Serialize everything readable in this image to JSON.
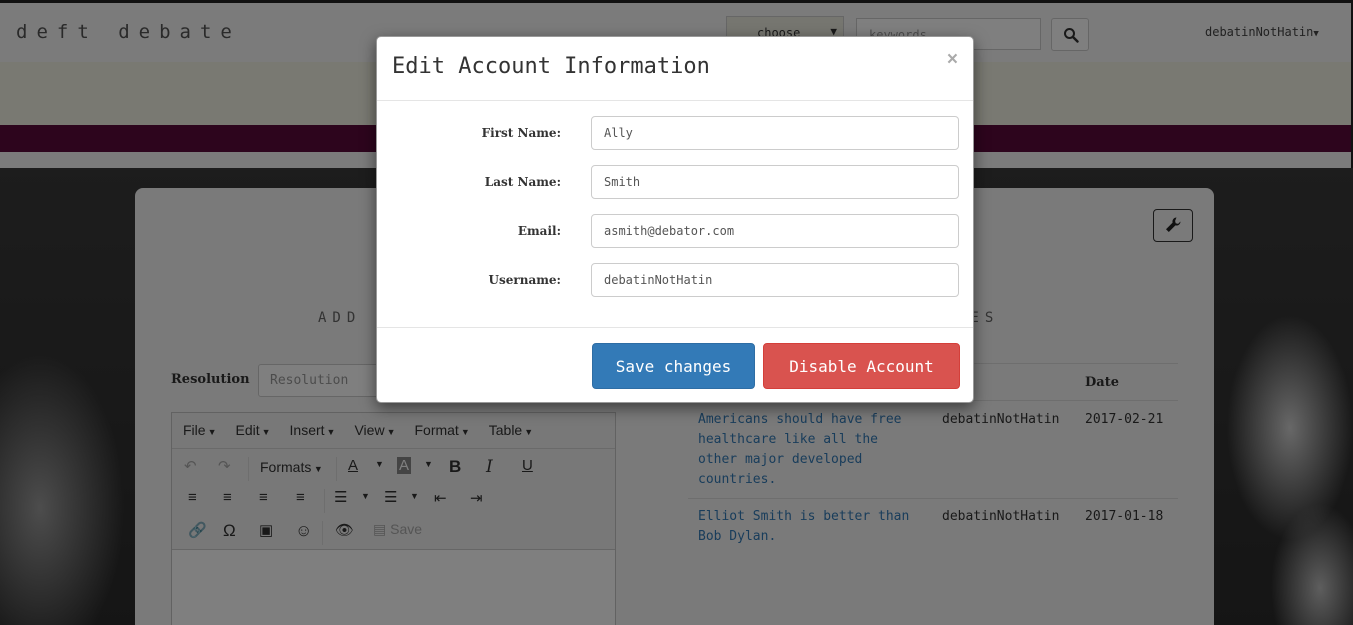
{
  "navbar": {
    "brand": "deft debate",
    "choose_label": "choose",
    "search_placeholder": "keywords",
    "user_label": "debatinNotHatin"
  },
  "panel": {
    "left_section_heading": "ADD",
    "right_section_heading": "TES",
    "resolution_label": "Resolution",
    "resolution_placeholder": "Resolution",
    "editor": {
      "menus": [
        "File",
        "Edit",
        "Insert",
        "View",
        "Format",
        "Table"
      ],
      "formats_label": "Formats",
      "save_label": "Save"
    },
    "table": {
      "date_header": "Date",
      "rows": [
        {
          "title": "Americans should have free healthcare like all the other major developed countries.",
          "title_lines": [
            "Americans should have free",
            "healthcare like all the",
            "other major developed",
            "countries."
          ],
          "user": "debatinNotHatin",
          "date": "2017-02-21"
        },
        {
          "title": "Elliot Smith is better than Bob Dylan.",
          "title_lines": [
            "Elliot Smith is better than",
            "Bob Dylan."
          ],
          "user": "debatinNotHatin",
          "date": "2017-01-18"
        }
      ]
    }
  },
  "modal": {
    "title": "Edit Account Information",
    "close": "×",
    "fields": [
      {
        "label": "First Name:",
        "value": "Ally"
      },
      {
        "label": "Last Name:",
        "value": "Smith"
      },
      {
        "label": "Email:",
        "value": "asmith@debator.com"
      },
      {
        "label": "Username:",
        "value": "debatinNotHatin"
      }
    ],
    "save_button": "Save changes",
    "disable_button": "Disable Account"
  },
  "colors": {
    "primary": "#337ab7",
    "danger": "#d9534f",
    "banner": "#5a0a3a"
  }
}
